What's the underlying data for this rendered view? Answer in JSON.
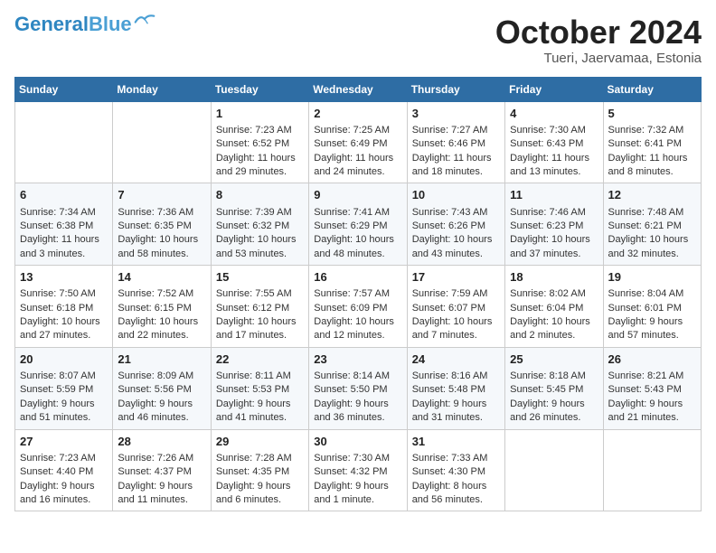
{
  "header": {
    "logo_line1": "General",
    "logo_line2": "Blue",
    "month": "October 2024",
    "location": "Tueri, Jaervamaa, Estonia"
  },
  "weekdays": [
    "Sunday",
    "Monday",
    "Tuesday",
    "Wednesday",
    "Thursday",
    "Friday",
    "Saturday"
  ],
  "weeks": [
    [
      {
        "day": "",
        "info": ""
      },
      {
        "day": "",
        "info": ""
      },
      {
        "day": "1",
        "info": "Sunrise: 7:23 AM\nSunset: 6:52 PM\nDaylight: 11 hours and 29 minutes."
      },
      {
        "day": "2",
        "info": "Sunrise: 7:25 AM\nSunset: 6:49 PM\nDaylight: 11 hours and 24 minutes."
      },
      {
        "day": "3",
        "info": "Sunrise: 7:27 AM\nSunset: 6:46 PM\nDaylight: 11 hours and 18 minutes."
      },
      {
        "day": "4",
        "info": "Sunrise: 7:30 AM\nSunset: 6:43 PM\nDaylight: 11 hours and 13 minutes."
      },
      {
        "day": "5",
        "info": "Sunrise: 7:32 AM\nSunset: 6:41 PM\nDaylight: 11 hours and 8 minutes."
      }
    ],
    [
      {
        "day": "6",
        "info": "Sunrise: 7:34 AM\nSunset: 6:38 PM\nDaylight: 11 hours and 3 minutes."
      },
      {
        "day": "7",
        "info": "Sunrise: 7:36 AM\nSunset: 6:35 PM\nDaylight: 10 hours and 58 minutes."
      },
      {
        "day": "8",
        "info": "Sunrise: 7:39 AM\nSunset: 6:32 PM\nDaylight: 10 hours and 53 minutes."
      },
      {
        "day": "9",
        "info": "Sunrise: 7:41 AM\nSunset: 6:29 PM\nDaylight: 10 hours and 48 minutes."
      },
      {
        "day": "10",
        "info": "Sunrise: 7:43 AM\nSunset: 6:26 PM\nDaylight: 10 hours and 43 minutes."
      },
      {
        "day": "11",
        "info": "Sunrise: 7:46 AM\nSunset: 6:23 PM\nDaylight: 10 hours and 37 minutes."
      },
      {
        "day": "12",
        "info": "Sunrise: 7:48 AM\nSunset: 6:21 PM\nDaylight: 10 hours and 32 minutes."
      }
    ],
    [
      {
        "day": "13",
        "info": "Sunrise: 7:50 AM\nSunset: 6:18 PM\nDaylight: 10 hours and 27 minutes."
      },
      {
        "day": "14",
        "info": "Sunrise: 7:52 AM\nSunset: 6:15 PM\nDaylight: 10 hours and 22 minutes."
      },
      {
        "day": "15",
        "info": "Sunrise: 7:55 AM\nSunset: 6:12 PM\nDaylight: 10 hours and 17 minutes."
      },
      {
        "day": "16",
        "info": "Sunrise: 7:57 AM\nSunset: 6:09 PM\nDaylight: 10 hours and 12 minutes."
      },
      {
        "day": "17",
        "info": "Sunrise: 7:59 AM\nSunset: 6:07 PM\nDaylight: 10 hours and 7 minutes."
      },
      {
        "day": "18",
        "info": "Sunrise: 8:02 AM\nSunset: 6:04 PM\nDaylight: 10 hours and 2 minutes."
      },
      {
        "day": "19",
        "info": "Sunrise: 8:04 AM\nSunset: 6:01 PM\nDaylight: 9 hours and 57 minutes."
      }
    ],
    [
      {
        "day": "20",
        "info": "Sunrise: 8:07 AM\nSunset: 5:59 PM\nDaylight: 9 hours and 51 minutes."
      },
      {
        "day": "21",
        "info": "Sunrise: 8:09 AM\nSunset: 5:56 PM\nDaylight: 9 hours and 46 minutes."
      },
      {
        "day": "22",
        "info": "Sunrise: 8:11 AM\nSunset: 5:53 PM\nDaylight: 9 hours and 41 minutes."
      },
      {
        "day": "23",
        "info": "Sunrise: 8:14 AM\nSunset: 5:50 PM\nDaylight: 9 hours and 36 minutes."
      },
      {
        "day": "24",
        "info": "Sunrise: 8:16 AM\nSunset: 5:48 PM\nDaylight: 9 hours and 31 minutes."
      },
      {
        "day": "25",
        "info": "Sunrise: 8:18 AM\nSunset: 5:45 PM\nDaylight: 9 hours and 26 minutes."
      },
      {
        "day": "26",
        "info": "Sunrise: 8:21 AM\nSunset: 5:43 PM\nDaylight: 9 hours and 21 minutes."
      }
    ],
    [
      {
        "day": "27",
        "info": "Sunrise: 7:23 AM\nSunset: 4:40 PM\nDaylight: 9 hours and 16 minutes."
      },
      {
        "day": "28",
        "info": "Sunrise: 7:26 AM\nSunset: 4:37 PM\nDaylight: 9 hours and 11 minutes."
      },
      {
        "day": "29",
        "info": "Sunrise: 7:28 AM\nSunset: 4:35 PM\nDaylight: 9 hours and 6 minutes."
      },
      {
        "day": "30",
        "info": "Sunrise: 7:30 AM\nSunset: 4:32 PM\nDaylight: 9 hours and 1 minute."
      },
      {
        "day": "31",
        "info": "Sunrise: 7:33 AM\nSunset: 4:30 PM\nDaylight: 8 hours and 56 minutes."
      },
      {
        "day": "",
        "info": ""
      },
      {
        "day": "",
        "info": ""
      }
    ]
  ]
}
